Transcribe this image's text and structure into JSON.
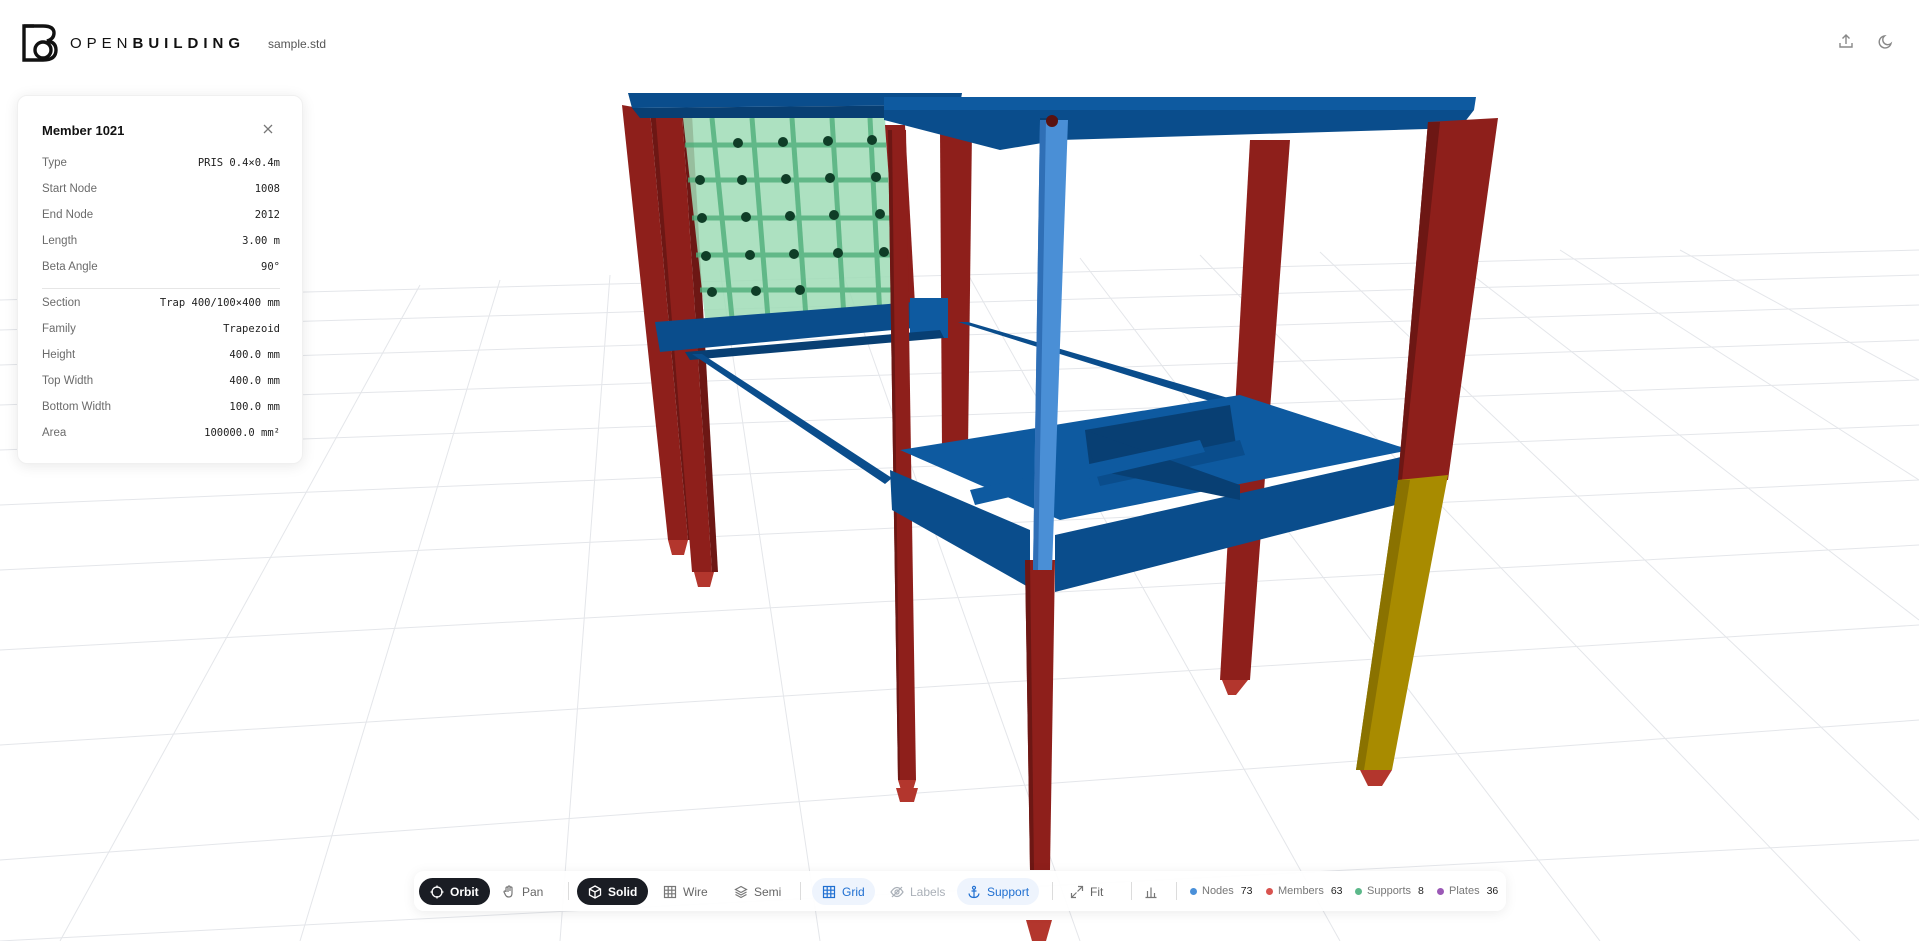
{
  "app": {
    "brand_light": "OPEN",
    "brand_bold": "BUILDING",
    "filename": "sample.std"
  },
  "header_actions": [
    {
      "icon": "upload-icon"
    },
    {
      "icon": "moon-icon"
    }
  ],
  "panel": {
    "title": "Member 1021",
    "close_icon": "close-icon",
    "rows": [
      {
        "label": "Type",
        "value": "PRIS 0.4×0.4m"
      },
      {
        "label": "Start Node",
        "value": "1008"
      },
      {
        "label": "End Node",
        "value": "2012"
      },
      {
        "label": "Length",
        "value": "3.00 m"
      },
      {
        "label": "Beta Angle",
        "value": "90°"
      },
      {
        "label": "Section",
        "value": "Trap 400/100×400 mm"
      },
      {
        "label": "Family",
        "value": "Trapezoid"
      },
      {
        "label": "Height",
        "value": "400.0 mm"
      },
      {
        "label": "Top Width",
        "value": "400.0 mm"
      },
      {
        "label": "Bottom Width",
        "value": "100.0 mm"
      },
      {
        "label": "Area",
        "value": "100000.0 mm²"
      }
    ]
  },
  "toolbar": {
    "orbit": "Orbit",
    "pan": "Pan",
    "solid": "Solid",
    "wire": "Wire",
    "semi": "Semi",
    "grid": "Grid",
    "labels": "Labels",
    "support": "Support",
    "fit": "Fit",
    "stats": [
      {
        "label": "Nodes",
        "count": "73",
        "color": "#4a90d9"
      },
      {
        "label": "Members",
        "count": "63",
        "color": "#d9534f"
      },
      {
        "label": "Supports",
        "count": "8",
        "color": "#5cb88a"
      },
      {
        "label": "Plates",
        "count": "36",
        "color": "#9b59b6"
      }
    ]
  },
  "colors": {
    "member_red": "#8e1f1b",
    "member_blue": "#0a4d8c",
    "selected_member": "#4a8fd6",
    "highlight_yellow": "#a88b00",
    "plate_green": "#7fcf9f"
  }
}
